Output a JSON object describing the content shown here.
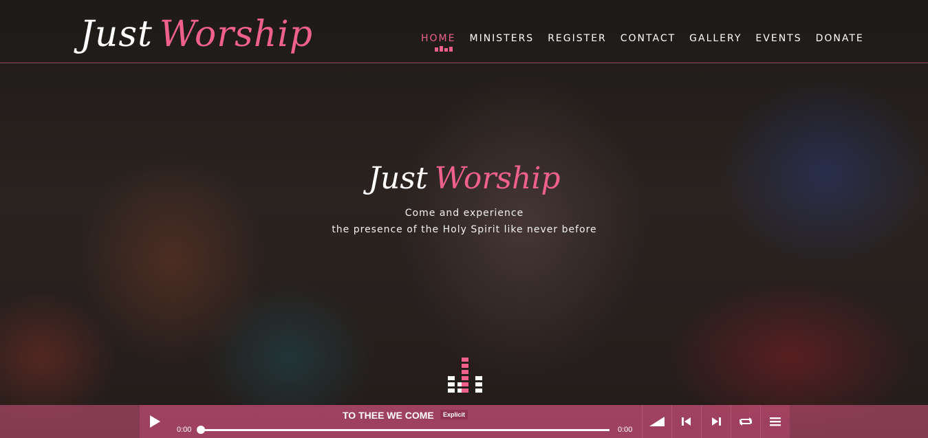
{
  "brand": {
    "word1": "Just",
    "word2": "Worship"
  },
  "nav": {
    "items": [
      {
        "label": "HOME",
        "active": true
      },
      {
        "label": "MINISTERS"
      },
      {
        "label": "REGISTER"
      },
      {
        "label": "CONTACT"
      },
      {
        "label": "GALLERY"
      },
      {
        "label": "EVENTS"
      },
      {
        "label": "DONATE"
      }
    ]
  },
  "hero": {
    "logo_word1": "Just",
    "logo_word2": "Worship",
    "line1": "Come and experience",
    "line2": "the presence of the Holy Spirit like never before"
  },
  "player": {
    "track_title": "TO THEE WE COME",
    "explicit_label": "Explicit",
    "current_time": "0:00",
    "duration": "0:00",
    "progress_fraction": 0,
    "icons": [
      "play-icon",
      "volume-icon",
      "previous-track-icon",
      "next-track-icon",
      "repeat-icon",
      "playlist-menu-icon"
    ]
  },
  "colors": {
    "accent": "#f0608f",
    "player_bar": "#d65682",
    "text": "#ffffff"
  }
}
